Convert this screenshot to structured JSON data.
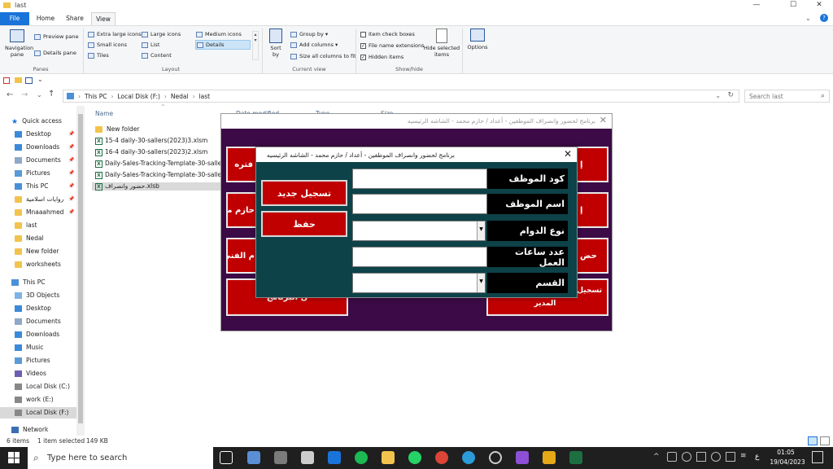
{
  "window": {
    "title": "last",
    "minimize": "—",
    "maximize": "☐",
    "close": "✕"
  },
  "ribbon_tabs": [
    "File",
    "Home",
    "Share",
    "View"
  ],
  "ribbon": {
    "navigation_pane": "Navigation pane",
    "preview_pane": "Preview pane",
    "details_pane": "Details pane",
    "panes_group": "Panes",
    "layouts": [
      "Extra large icons",
      "Large icons",
      "Medium icons",
      "Small icons",
      "List",
      "Details",
      "Tiles",
      "Content"
    ],
    "layout_group": "Layout",
    "sort_by": "Sort by",
    "group_by": "Group by",
    "add_columns": "Add columns",
    "size_all_columns": "Size all columns to fit",
    "current_view_group": "Current view",
    "item_check_boxes": "Item check boxes",
    "file_name_extensions": "File name extensions",
    "hidden_items": "Hidden items",
    "hide_selected_items": "Hide selected items",
    "show_hide_group": "Show/hide",
    "options": "Options"
  },
  "address": {
    "path": [
      "This PC",
      "Local Disk (F:)",
      "Nedal",
      "last"
    ],
    "search_placeholder": "Search last"
  },
  "nav": {
    "quick_access": "Quick access",
    "quick_items": [
      "Desktop",
      "Downloads",
      "Documents",
      "Pictures",
      "This PC",
      "روايات اسلامية",
      "Mnaaahmed",
      "last",
      "Nedal",
      "New folder",
      "worksheets"
    ],
    "this_pc": "This PC",
    "pc_items": [
      "3D Objects",
      "Desktop",
      "Documents",
      "Downloads",
      "Music",
      "Pictures",
      "Videos",
      "Local Disk (C:)",
      "work (E:)",
      "Local Disk (F:)"
    ],
    "network": "Network"
  },
  "columns": {
    "name": "Name",
    "date_modified": "Date modified",
    "type": "Type",
    "size": "Size"
  },
  "files": [
    "New folder",
    "15-4 daily-30-sallers(2023)3.xlsm",
    "16-4 daily-30-sallers(2023)2.xlsm",
    "Daily-Sales-Tracking-Template-30-salle",
    "Daily-Sales-Tracking-Template-30-salle",
    "حضور وانصراف.xlsb"
  ],
  "status": {
    "items": "6 items",
    "selected": "1 item selected",
    "size": "149 KB"
  },
  "taskbar": {
    "search": "Type here to search",
    "time": "01:05",
    "date": "19/04/2023",
    "lang": "ع"
  },
  "main_form": {
    "caption": "برنامج لحضور وانصراف الموظفين - أعداد / حازم محمد - الشاشه الرئيسيه",
    "close": "✕",
    "buttons": [
      "فتره",
      "حازم محمد",
      "م الفنى",
      "ل البرنامج",
      "إ",
      "إ",
      "حض",
      "تسجيل",
      "المدير"
    ]
  },
  "dialog": {
    "caption": "برنامج لحضور وانصراف الموظفين - أعداد / حازم محمد - الشاشه الرئيسيه",
    "close": "✕",
    "new_button": "تسجيل جديد",
    "save_button": "حفظ",
    "fields": [
      "كود الموظف",
      "اسم الموظف",
      "نوع الدوام",
      "عدد ساعات العمل",
      "القسم"
    ]
  },
  "colors": {
    "main_bg": "#3c0a46",
    "dialog_bg": "#0d4248",
    "button_red": "#c00000",
    "file_tab": "#1a73d9"
  }
}
